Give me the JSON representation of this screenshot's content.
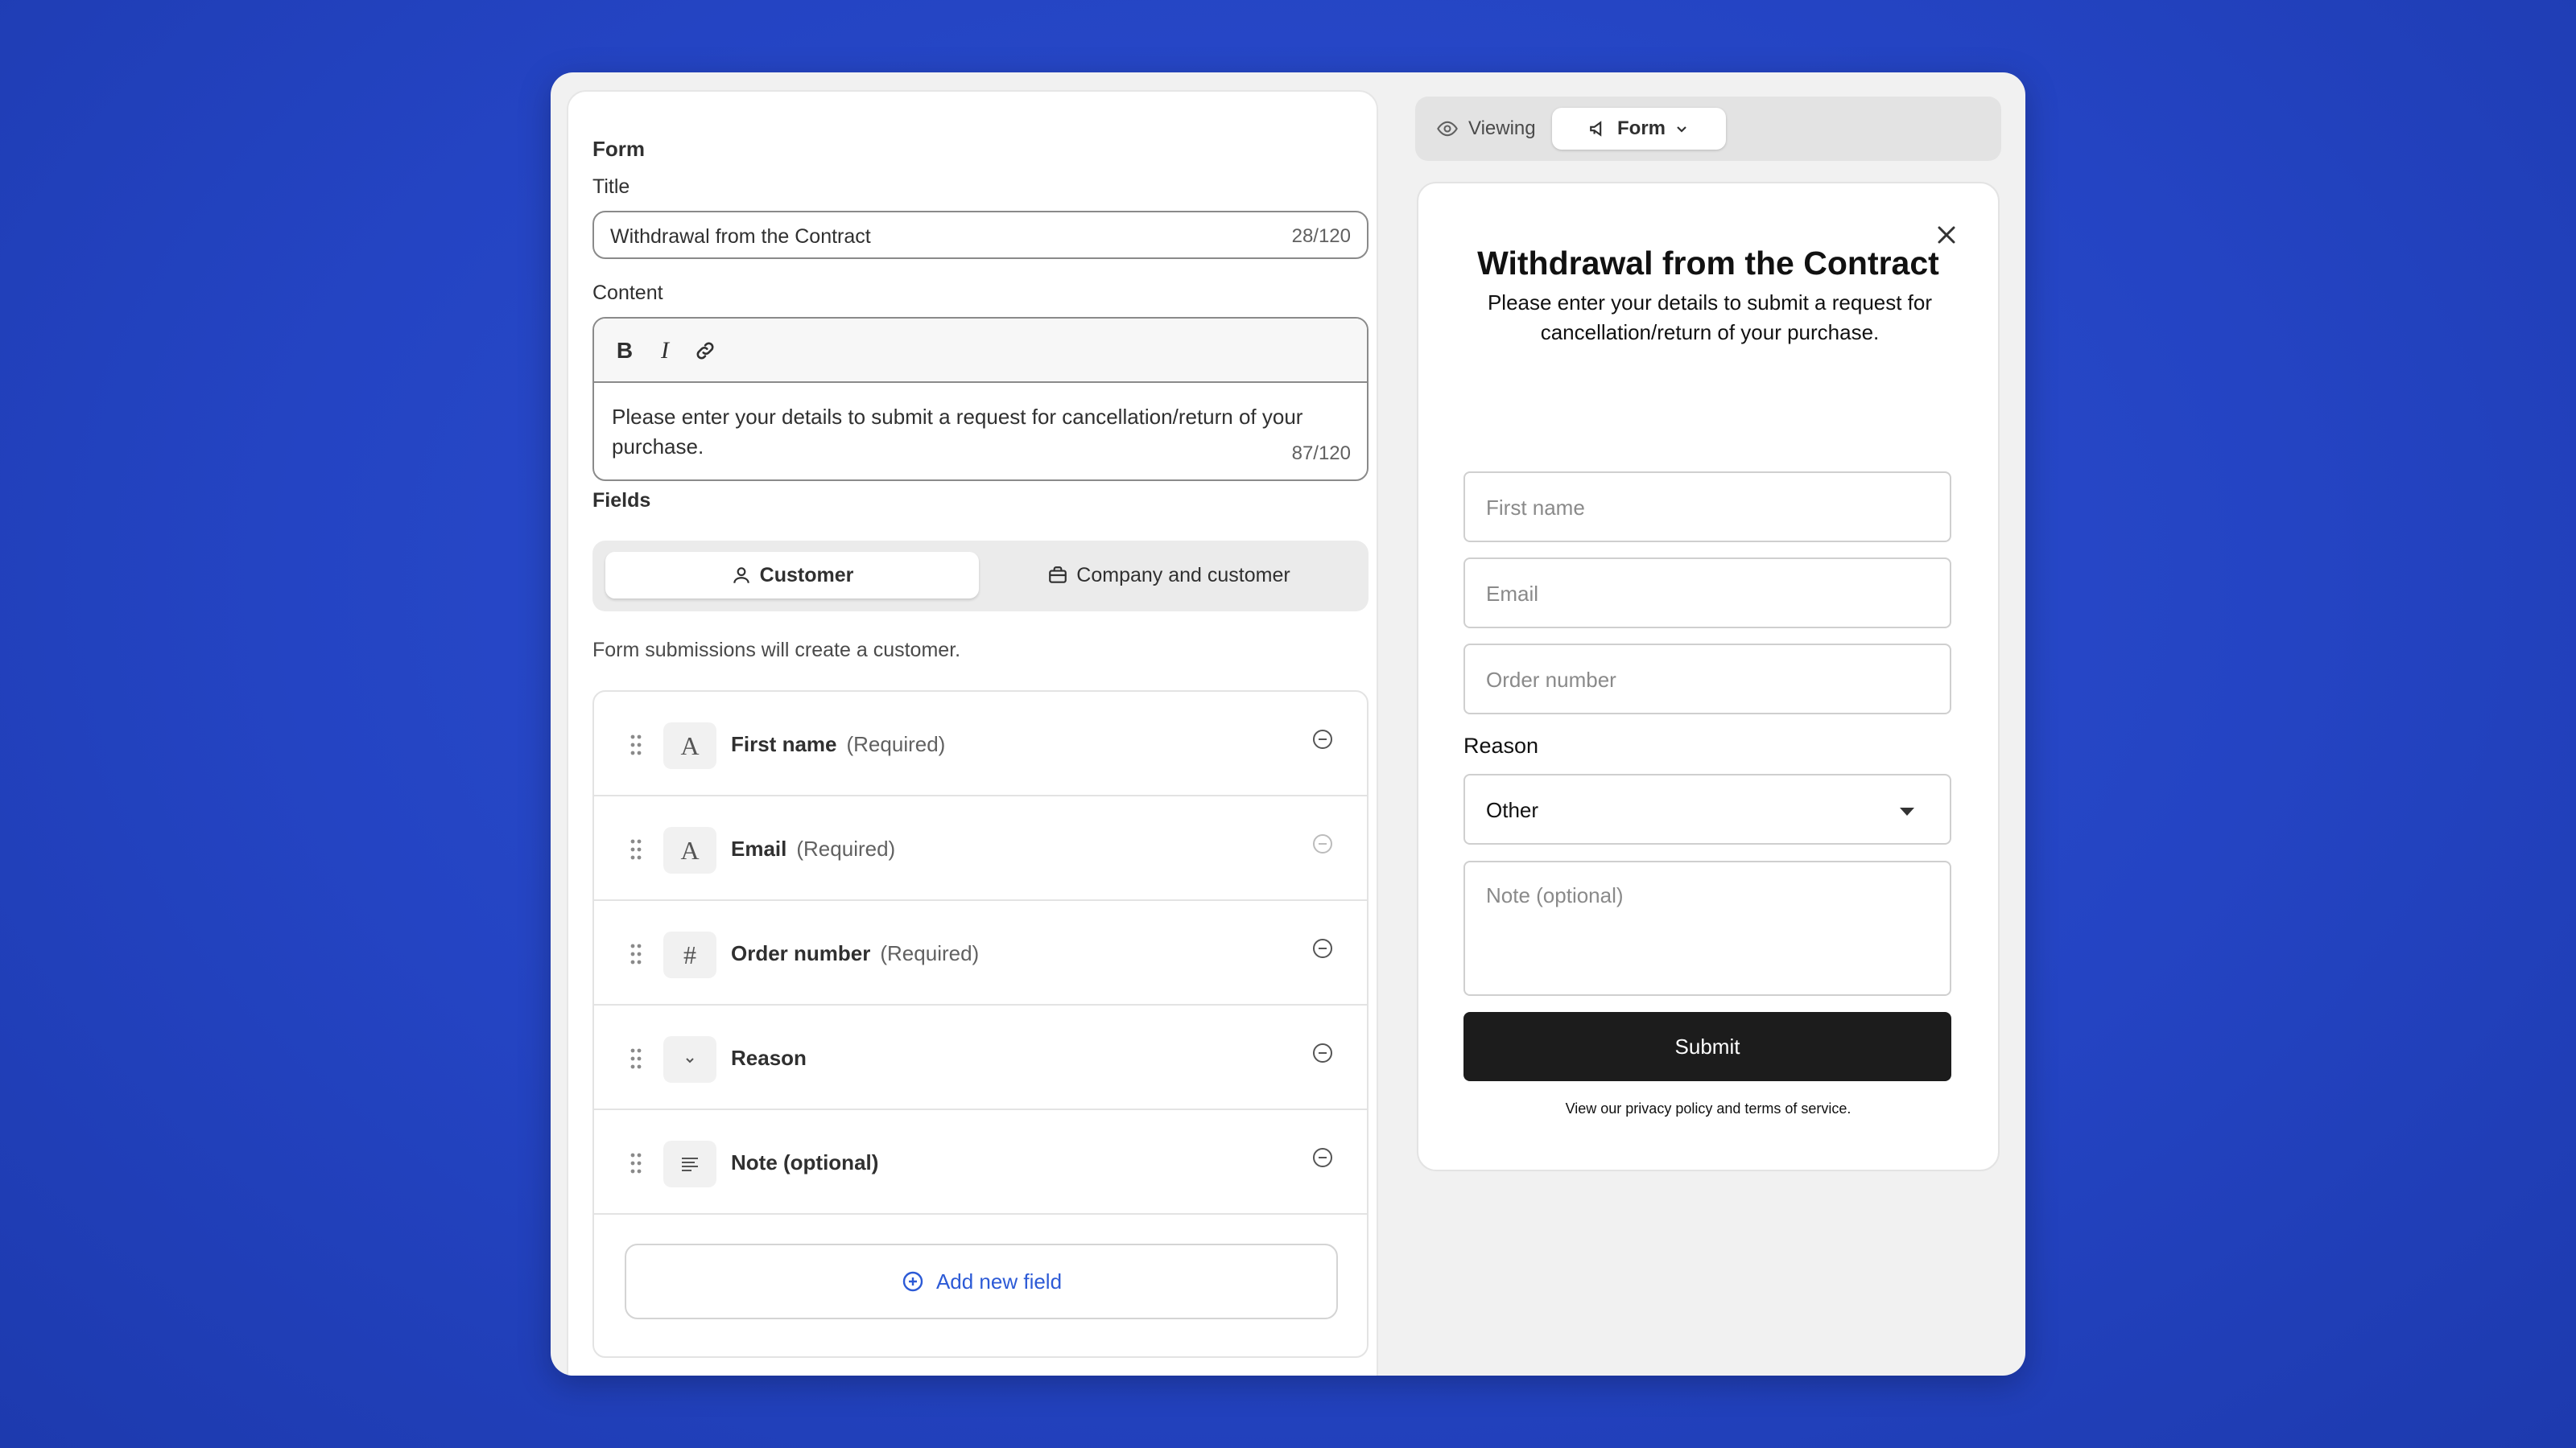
{
  "editor": {
    "section_title": "Form",
    "title_label": "Title",
    "title_value": "Withdrawal from the Contract",
    "title_counter": "28/120",
    "content_label": "Content",
    "toolbar": {
      "bold": "B",
      "italic": "I",
      "link_icon": "link-icon"
    },
    "content_value": "Please enter your details to submit a request for cancellation/return of your purchase.",
    "content_counter": "87/120",
    "fields_label": "Fields",
    "segments": {
      "customer": "Customer",
      "company": "Company and customer"
    },
    "helper": "Form submissions will create a customer.",
    "fields": [
      {
        "name": "First name",
        "required": "(Required)",
        "type_icon": "text-A-icon"
      },
      {
        "name": "Email",
        "required": "(Required)",
        "type_icon": "text-A-icon"
      },
      {
        "name": "Order number",
        "required": "(Required)",
        "type_icon": "hash-icon"
      },
      {
        "name": "Reason",
        "required": "",
        "type_icon": "chevron-down-icon"
      },
      {
        "name": "Note (optional)",
        "required": "",
        "type_icon": "paragraph-icon"
      }
    ],
    "add_field": "Add new field"
  },
  "preview": {
    "viewing_label": "Viewing",
    "form_select": "Form",
    "modal": {
      "title": "Withdrawal from the Contract",
      "description": "Please enter your details to submit a request for cancellation/return of your purchase.",
      "first_name_placeholder": "First name",
      "email_placeholder": "Email",
      "order_placeholder": "Order number",
      "reason_label": "Reason",
      "reason_value": "Other",
      "note_placeholder": "Note (optional)",
      "submit": "Submit",
      "footer": "View our privacy policy and terms of service."
    }
  },
  "colors": {
    "background": "#2444c3",
    "accent_link": "#2c5ad6",
    "submit_bg": "#1c1c1c"
  }
}
